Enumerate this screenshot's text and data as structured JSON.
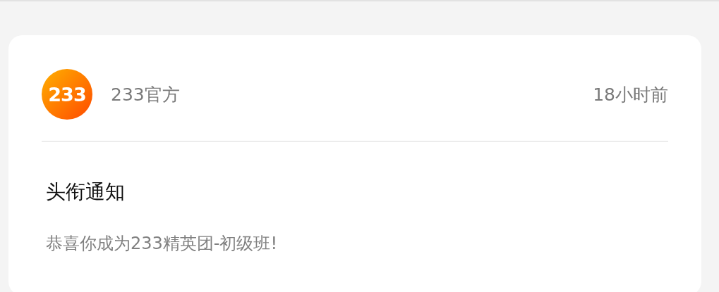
{
  "message": {
    "avatar_text": "233",
    "sender": "233官方",
    "time": "18小时前",
    "title": "头衔通知",
    "body": "恭喜你成为233精英团-初级班!"
  }
}
